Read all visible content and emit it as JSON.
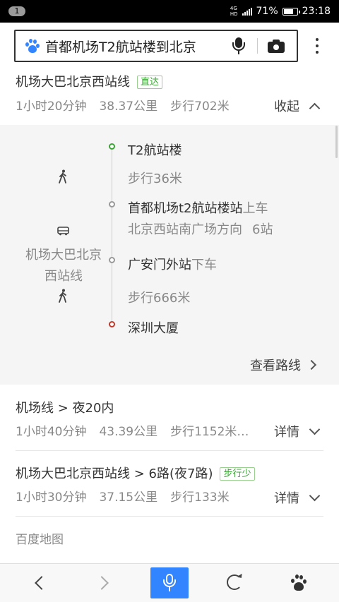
{
  "status_bar": {
    "notification_count": "1",
    "network_top": "4G",
    "network_bottom": "HD",
    "battery_percent_label": "71%",
    "battery_level": 0.71,
    "time": "23:18"
  },
  "search": {
    "query": "首都机场T2航站楼到北京",
    "icons": [
      "baidu-paw-icon",
      "mic-icon",
      "camera-icon",
      "more-vertical-icon"
    ]
  },
  "routes": [
    {
      "title": "机场大巴北京西站线",
      "tag": "直达",
      "duration": "1小时20分钟",
      "distance": "38.37公里",
      "walk": "步行702米",
      "toggle_label": "收起",
      "expanded": true,
      "steps": {
        "start": "T2航站楼",
        "walk_1": "步行36米",
        "board_station": "首都机场t2航站楼站",
        "board_action": "上车",
        "direction": "北京西站南广场方向",
        "stop_count": "6站",
        "line_name_line1": "机场大巴北京",
        "line_name_line2": "西站线",
        "alight_station": "广安门外站",
        "alight_action": "下车",
        "walk_2": "步行666米",
        "end": "深圳大厦"
      },
      "view_route_label": "查看路线"
    },
    {
      "title": "机场线 > 夜20内",
      "duration": "1小时40分钟",
      "distance": "43.39公里",
      "walk": "步行1152米…",
      "toggle_label": "详情"
    },
    {
      "title": "机场大巴北京西站线 > 6路(夜7路)",
      "tag": "步行少",
      "duration": "1小时30分钟",
      "distance": "37.15公里",
      "walk": "步行133米",
      "toggle_label": "详情"
    }
  ],
  "footer": {
    "brand": "百度地图"
  },
  "bottom_nav": {
    "icons": [
      "back-icon",
      "forward-icon",
      "voice-search-icon",
      "refresh-icon",
      "baidu-home-icon"
    ],
    "accent_color": "#3385ff"
  },
  "colors": {
    "accent": "#3385ff",
    "tag_green": "#3aa534",
    "start_node": "#3aa534",
    "end_node": "#c0392b"
  }
}
